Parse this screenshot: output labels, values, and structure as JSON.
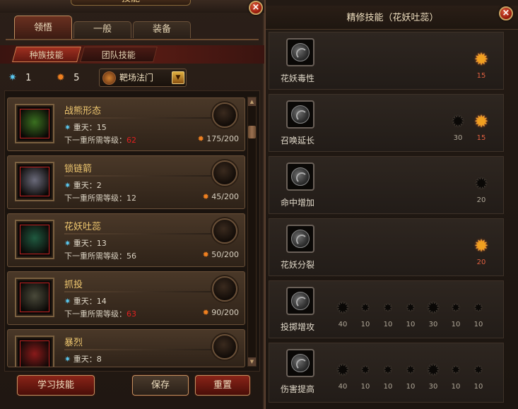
{
  "left_window": {
    "title": "技能",
    "close_label": "×",
    "tabs": [
      {
        "label": "领悟",
        "active": true
      },
      {
        "label": "一般",
        "active": false
      },
      {
        "label": "装备",
        "active": false
      }
    ],
    "subtabs": [
      {
        "label": "种族技能",
        "active": true
      },
      {
        "label": "团队技能",
        "active": false
      }
    ],
    "resources": {
      "blue_points": "1",
      "orange_points": "5"
    },
    "dropdown": {
      "selected": "靶场法门",
      "arrow": "▼"
    },
    "skills": [
      {
        "name": "战熊形态",
        "level_text": "重天：15",
        "req_label": "下一重所需等级：",
        "req_value": "62",
        "req_ok": false,
        "cost": "175/200",
        "icon_color": "#3a7020"
      },
      {
        "name": "锁链箭",
        "level_text": "重天：2",
        "req_label": "下一重所需等级：",
        "req_value": "12",
        "req_ok": true,
        "cost": "45/200",
        "icon_color": "#6a6a7a"
      },
      {
        "name": "花妖吐蕊",
        "level_text": "重天：13",
        "req_label": "下一重所需等级：",
        "req_value": "56",
        "req_ok": true,
        "cost": "50/200",
        "icon_color": "#205a40"
      },
      {
        "name": "抓投",
        "level_text": "重天：14",
        "req_label": "下一重所需等级：",
        "req_value": "63",
        "req_ok": false,
        "cost": "90/200",
        "icon_color": "#4a4a3a"
      },
      {
        "name": "暴烈",
        "level_text": "重天：8",
        "req_label": "",
        "req_value": "",
        "req_ok": true,
        "cost": "",
        "icon_color": "#8a1a1a"
      }
    ],
    "buttons": {
      "learn": "学习技能",
      "save": "保存",
      "reset": "重置"
    },
    "scroll": {
      "up": "▲",
      "down": "▼"
    }
  },
  "right_window": {
    "title": "精修技能（花妖吐蕊）",
    "close_label": "×",
    "rows": [
      {
        "label": "花妖毒性",
        "stars": [
          {
            "value": "15",
            "lit": true,
            "big": true
          }
        ]
      },
      {
        "label": "召唤延长",
        "stars": [
          {
            "value": "30",
            "lit": false,
            "big": true
          },
          {
            "value": "15",
            "lit": true,
            "big": true
          }
        ]
      },
      {
        "label": "命中增加",
        "stars": [
          {
            "value": "20",
            "lit": false,
            "big": true
          }
        ]
      },
      {
        "label": "花妖分裂",
        "stars": [
          {
            "value": "20",
            "lit": true,
            "big": true
          }
        ]
      },
      {
        "label": "投掷增攻",
        "stars": [
          {
            "value": "40",
            "lit": false,
            "big": true
          },
          {
            "value": "10",
            "lit": false,
            "big": false
          },
          {
            "value": "10",
            "lit": false,
            "big": false
          },
          {
            "value": "10",
            "lit": false,
            "big": false
          },
          {
            "value": "30",
            "lit": false,
            "big": true
          },
          {
            "value": "10",
            "lit": false,
            "big": false
          },
          {
            "value": "10",
            "lit": false,
            "big": false
          }
        ]
      },
      {
        "label": "伤害提高",
        "stars": [
          {
            "value": "40",
            "lit": false,
            "big": true
          },
          {
            "value": "10",
            "lit": false,
            "big": false
          },
          {
            "value": "10",
            "lit": false,
            "big": false
          },
          {
            "value": "10",
            "lit": false,
            "big": false
          },
          {
            "value": "30",
            "lit": false,
            "big": true
          },
          {
            "value": "10",
            "lit": false,
            "big": false
          },
          {
            "value": "10",
            "lit": false,
            "big": false
          }
        ]
      }
    ]
  }
}
